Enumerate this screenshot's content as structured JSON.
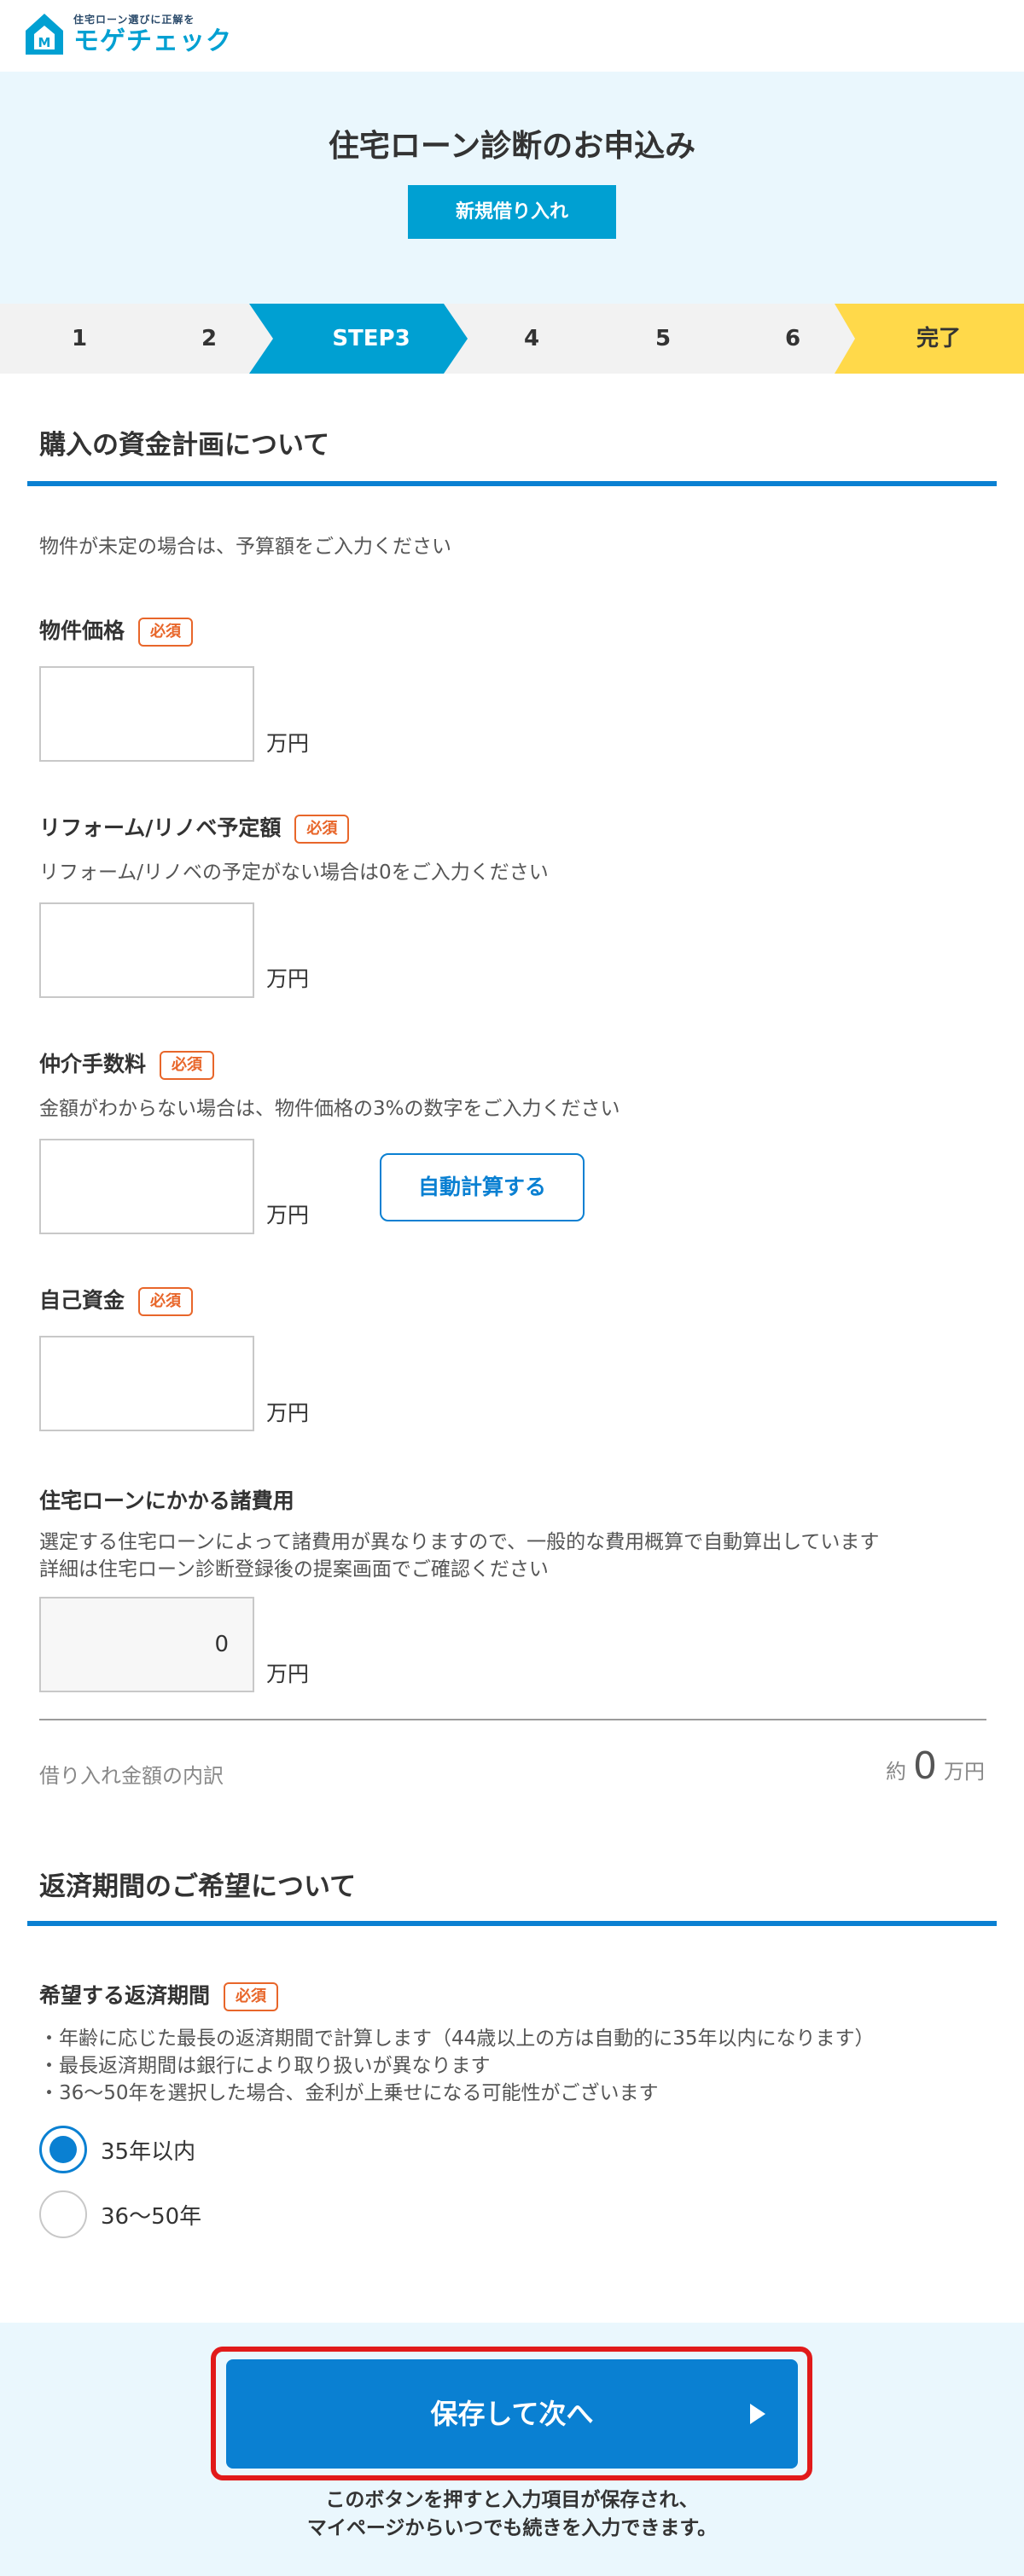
{
  "header": {
    "tagline": "住宅ローン選びに正解を",
    "brand": "モゲチェック"
  },
  "hero": {
    "title": "住宅ローン診断のお申込み",
    "badge": "新規借り入れ"
  },
  "steps": {
    "items": [
      "1",
      "2",
      "STEP3",
      "4",
      "5",
      "6",
      "完了"
    ],
    "current": "STEP3"
  },
  "funding": {
    "title": "購入の資金計画について",
    "intro": "物件が未定の場合は、予算額をご入力ください",
    "required_label": "必須",
    "unit": "万円",
    "property_price": {
      "label": "物件価格",
      "value": ""
    },
    "renovation": {
      "label": "リフォーム/リノベ予定額",
      "help": "リフォーム/リノベの予定がない場合は0をご入力ください",
      "value": ""
    },
    "brokerage": {
      "label": "仲介手数料",
      "help": "金額がわからない場合は、物件価格の3%の数字をご入力ください",
      "value": "",
      "calc_button": "自動計算する"
    },
    "own_funds": {
      "label": "自己資金",
      "value": ""
    },
    "loan_costs": {
      "label": "住宅ローンにかかる諸費用",
      "help_line1": "選定する住宅ローンによって諸費用が異なりますので、一般的な費用概算で自動算出しています",
      "help_line2": "詳細は住宅ローン診断登録後の提案画面でご確認ください",
      "value": "0"
    },
    "breakdown": {
      "label": "借り入れ金額の内訳",
      "prefix": "約",
      "amount": "0",
      "unit": "万円"
    }
  },
  "repayment": {
    "title": "返済期間のご希望について",
    "label": "希望する返済期間",
    "required_label": "必須",
    "notes": [
      "・年齢に応じた最長の返済期間で計算します（44歳以上の方は自動的に35年以内になります）",
      "・最長返済期間は銀行により取り扱いが異なります",
      "・36〜50年を選択した場合、金利が上乗せになる可能性がございます"
    ],
    "options": [
      {
        "label": "35年以内",
        "checked": true
      },
      {
        "label": "36〜50年",
        "checked": false
      }
    ]
  },
  "footer": {
    "save_label": "保存して次へ",
    "note_line1": "このボタンを押すと入力項目が保存され、",
    "note_line2": "マイページからいつでも続きを入力できます。"
  },
  "colors": {
    "primary": "#0a80d2",
    "accent": "#00a0d2",
    "complete": "#ffd94a",
    "required": "#e8662a",
    "highlight": "#e11a1a"
  }
}
